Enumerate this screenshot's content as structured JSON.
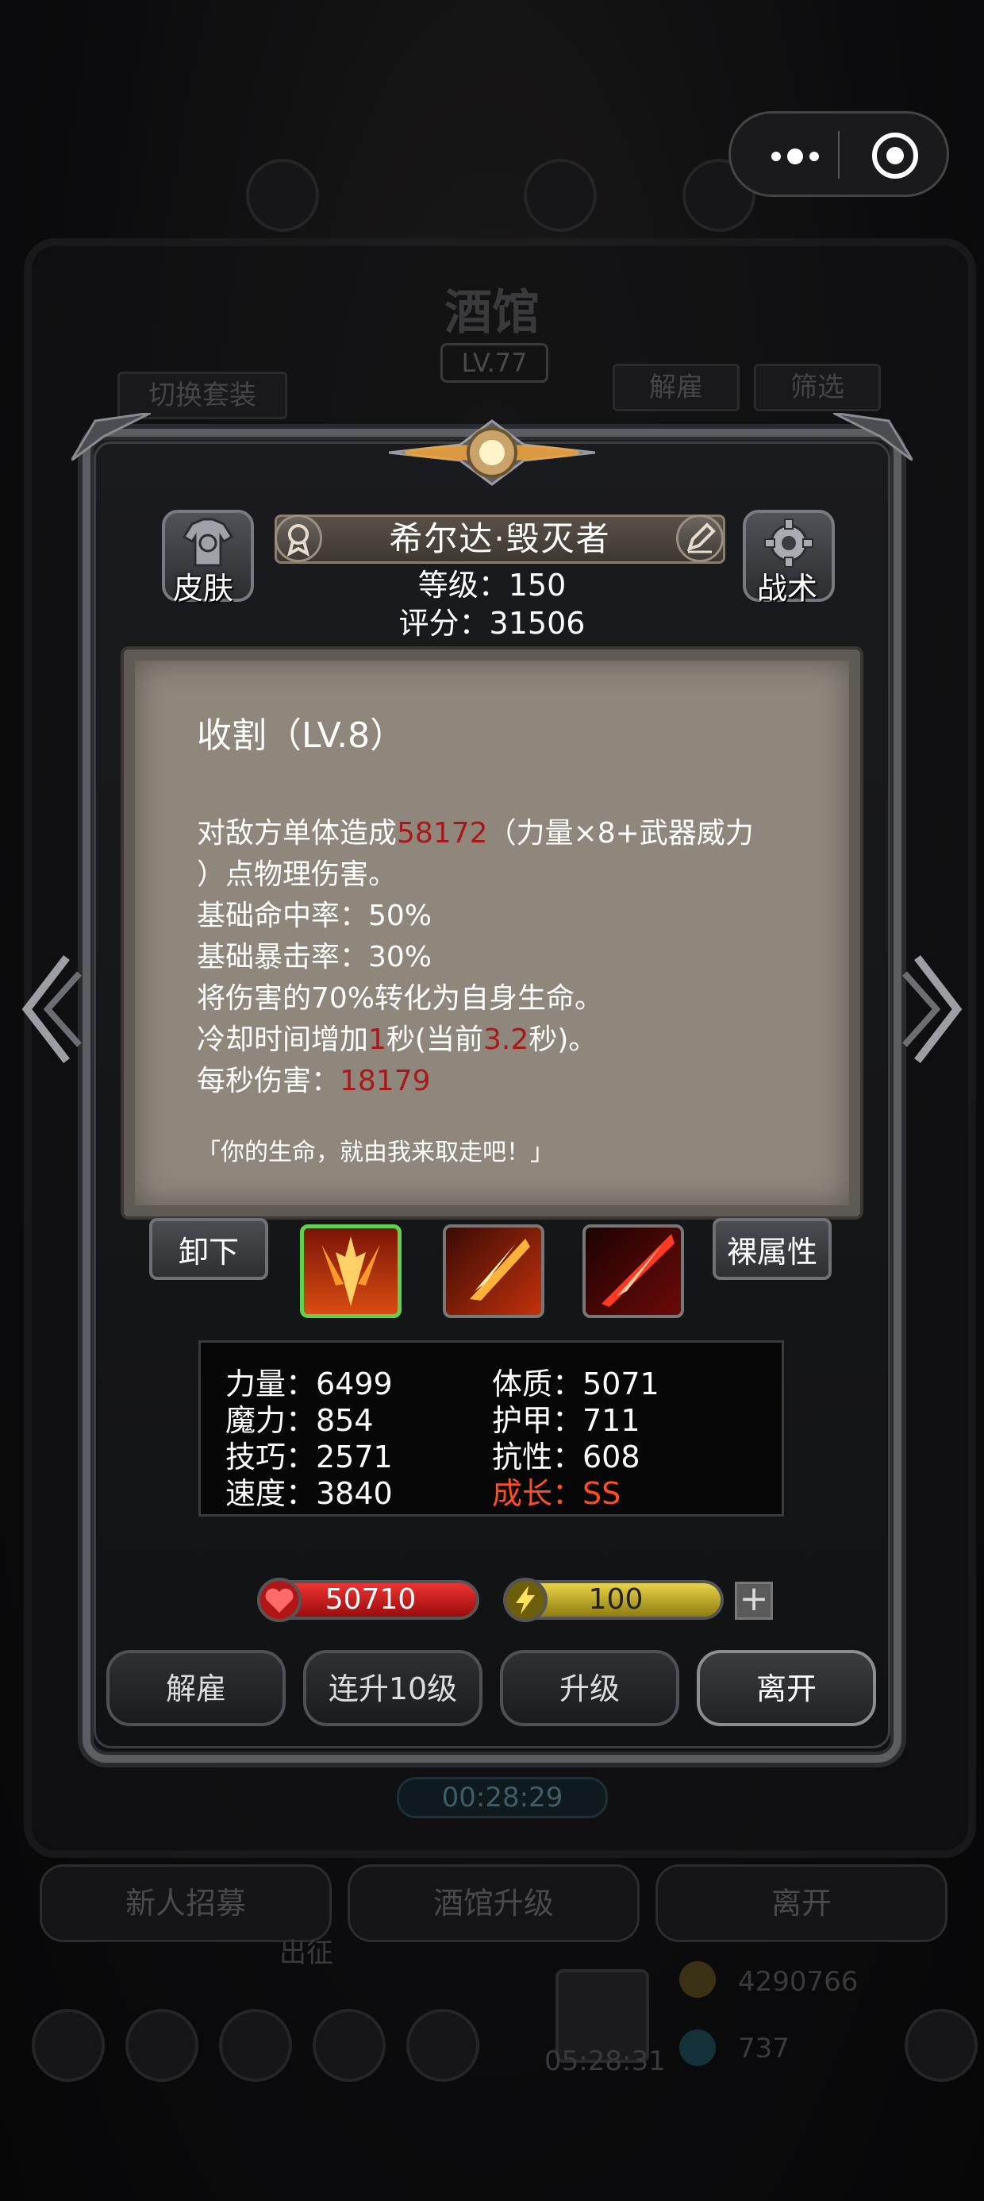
{
  "background": {
    "title": "酒馆",
    "level": "LV.77",
    "switch_outfit": "切换套装",
    "dismiss": "解雇",
    "filter": "筛选",
    "timer_1": "00:28:29",
    "timer_2": "05:28:31",
    "recruit": "新人招募",
    "upgrade_tavern": "酒馆升级",
    "leave": "离开",
    "expedition": "出征",
    "gold": "4290766",
    "gems": "737"
  },
  "capsule": {
    "more_icon": "more-dots-icon",
    "close_icon": "target-close-icon"
  },
  "hero": {
    "skin_label": "皮肤",
    "tactics_label": "战术",
    "name": "希尔达·毁灭者",
    "level_text": "等级：150",
    "score_text": "评分：31506"
  },
  "tooltip": {
    "title": "收割（LV.8）",
    "line1_a": "对敌方单体造成",
    "line1_damage": "58172",
    "line1_b": "（力量×8+武器威力",
    "line2": "）点物理伤害。",
    "hit_rate": "基础命中率：50%",
    "crit_rate": "基础暴击率：30%",
    "lifesteal": "将伤害的70%转化为自身生命。",
    "cd_a": "冷却时间增加",
    "cd_value": "1",
    "cd_b": "秒(当前",
    "cd_current": "3.2",
    "cd_c": "秒)。",
    "dps_label": "每秒伤害：",
    "dps_value": "18179",
    "quote": "「你的生命，就由我来取走吧！」"
  },
  "skill_row": {
    "unequip": "卸下",
    "naked_stats": "裸属性",
    "skills": [
      "harvest-skill-icon",
      "fire-slash-skill-icon",
      "blood-slash-skill-icon"
    ]
  },
  "stats": {
    "strength": "力量：6499",
    "magic": "魔力：854",
    "skill": "技巧：2571",
    "speed": "速度：3840",
    "constitution": "体质：5071",
    "armor": "护甲：711",
    "resistance": "抗性：608",
    "growth": "成长：SS"
  },
  "resources": {
    "hp": "50710",
    "energy": "100",
    "add": "+"
  },
  "actions": {
    "dismiss": "解雇",
    "level_up_10": "连升10级",
    "level_up": "升级",
    "leave": "离开"
  },
  "colors": {
    "damage_red": "#a81a1a",
    "growth_orange": "#ff4e1c",
    "skill_selected": "#5fd14a"
  }
}
